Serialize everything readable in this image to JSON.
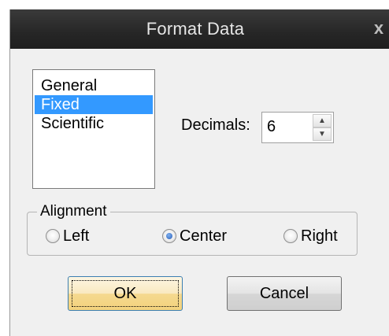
{
  "window": {
    "title": "Format Data",
    "close_glyph": "x"
  },
  "format_list": {
    "items": [
      "General",
      "Fixed",
      "Scientific"
    ],
    "selected": "Fixed"
  },
  "decimals": {
    "label": "Decimals:",
    "value": "6",
    "up_icon": "▲",
    "down_icon": "▼"
  },
  "alignment": {
    "legend": "Alignment",
    "options": [
      "Left",
      "Center",
      "Right"
    ],
    "selected": "Center"
  },
  "buttons": {
    "ok": "OK",
    "cancel": "Cancel"
  },
  "colors": {
    "selection": "#3399ff",
    "titlebar": "#262626",
    "ok_button": "#f5d98f"
  }
}
